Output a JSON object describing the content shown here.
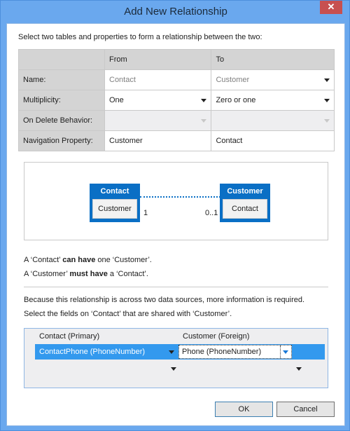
{
  "window": {
    "title": "Add New Relationship",
    "close_label": "✕"
  },
  "instruction": "Select two tables and properties to form a relationship between the two:",
  "grid": {
    "headers": {
      "from": "From",
      "to": "To"
    },
    "rows": [
      {
        "label": "Name:",
        "from": "Contact",
        "to": "Customer"
      },
      {
        "label": "Multiplicity:",
        "from": "One",
        "to": "Zero or one"
      },
      {
        "label": "On Delete Behavior:",
        "from": "",
        "to": ""
      },
      {
        "label": "Navigation Property:",
        "from": "Customer",
        "to": "Contact"
      }
    ]
  },
  "diagram": {
    "left": {
      "entity": "Contact",
      "property": "Customer",
      "multiplicity": "1"
    },
    "right": {
      "entity": "Customer",
      "property": "Contact",
      "multiplicity": "0..1"
    },
    "color": "#0a6fc5"
  },
  "sentences": {
    "s1": {
      "a": "A ‘Contact’ ",
      "b": "can have",
      "c": " one ‘Customer’."
    },
    "s2": {
      "a": "A ‘Customer’ ",
      "b": "must have",
      "c": " a ‘Contact’."
    },
    "info1": "Because this relationship is across two data sources, more information is required.",
    "info2": "Select the fields on ‘Contact’ that are shared with ‘Customer’."
  },
  "mapping": {
    "header_primary": "Contact (Primary)",
    "header_foreign": "Customer (Foreign)",
    "rows": [
      {
        "primary": "ContactPhone (PhoneNumber)",
        "foreign": "Phone (PhoneNumber)"
      },
      {
        "primary": "",
        "foreign": ""
      }
    ],
    "selection_color": "#3399ee"
  },
  "buttons": {
    "ok": "OK",
    "cancel": "Cancel"
  }
}
